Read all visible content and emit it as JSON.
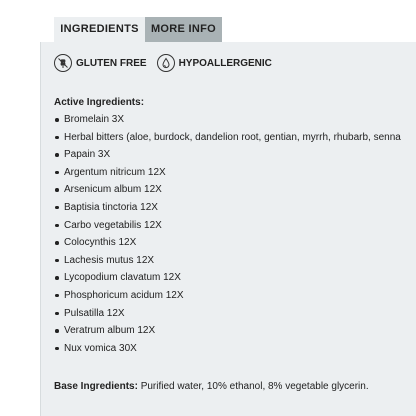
{
  "tabs": [
    {
      "label": "INGREDIENTS",
      "active": true
    },
    {
      "label": "MORE INFO",
      "active": false
    }
  ],
  "badges": [
    {
      "icon": "wheat-crossed-icon",
      "label": "GLUTEN FREE"
    },
    {
      "icon": "drop-icon",
      "label": "HYPOALLERGENIC"
    }
  ],
  "active_ingredients": {
    "title": "Active Ingredients:",
    "items": [
      "Bromelain 3X",
      "Herbal bitters (aloe, burdock, dandelion root, gentian, myrrh, rhubarb, senna",
      "Papain 3X",
      "Argentum nitricum 12X",
      "Arsenicum album 12X",
      "Baptisia tinctoria 12X",
      "Carbo vegetabilis 12X",
      "Colocynthis 12X",
      "Lachesis mutus 12X",
      "Lycopodium clavatum 12X",
      "Phosphoricum acidum 12X",
      "Pulsatilla 12X",
      "Veratrum album 12X",
      "Nux vomica 30X"
    ]
  },
  "base_ingredients": {
    "label": "Base Ingredients:",
    "text": " Purified water, 10% ethanol, 8% vegetable glycerin."
  },
  "colors": {
    "panel_bg": "#eceff1",
    "inactive_tab_bg": "#a9b2b5",
    "text": "#222222"
  }
}
